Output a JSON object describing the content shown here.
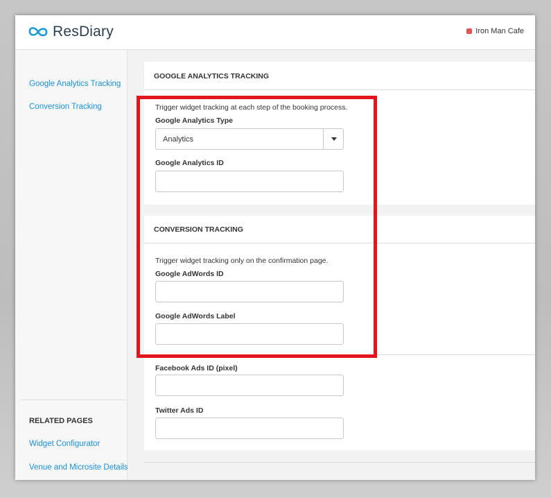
{
  "header": {
    "logo_text": "ResDiary",
    "venue_name": "Iron Man Cafe",
    "venue_indicator_color": "#e55353",
    "brand_color": "#1a9ad6"
  },
  "sidebar": {
    "nav_items": [
      {
        "label": "Google Analytics Tracking"
      },
      {
        "label": "Conversion Tracking"
      }
    ],
    "related_heading": "RELATED PAGES",
    "related_items": [
      {
        "label": "Widget Configurator"
      },
      {
        "label": "Venue and Microsite Details"
      }
    ],
    "link_color": "#1a8fd6"
  },
  "google_analytics": {
    "heading": "GOOGLE ANALYTICS TRACKING",
    "description": "Trigger widget tracking at each step of the booking process.",
    "type_label": "Google Analytics Type",
    "type_value": "Analytics",
    "id_label": "Google Analytics ID",
    "id_value": ""
  },
  "conversion": {
    "heading": "CONVERSION TRACKING",
    "description": "Trigger widget tracking only on the confirmation page.",
    "adwords_id_label": "Google AdWords ID",
    "adwords_id_value": "",
    "adwords_label_label": "Google AdWords Label",
    "adwords_label_value": "",
    "facebook_label": "Facebook Ads ID (pixel)",
    "facebook_value": "",
    "twitter_label": "Twitter Ads ID",
    "twitter_value": ""
  },
  "annotation": {
    "highlight_color": "#e3141b"
  }
}
